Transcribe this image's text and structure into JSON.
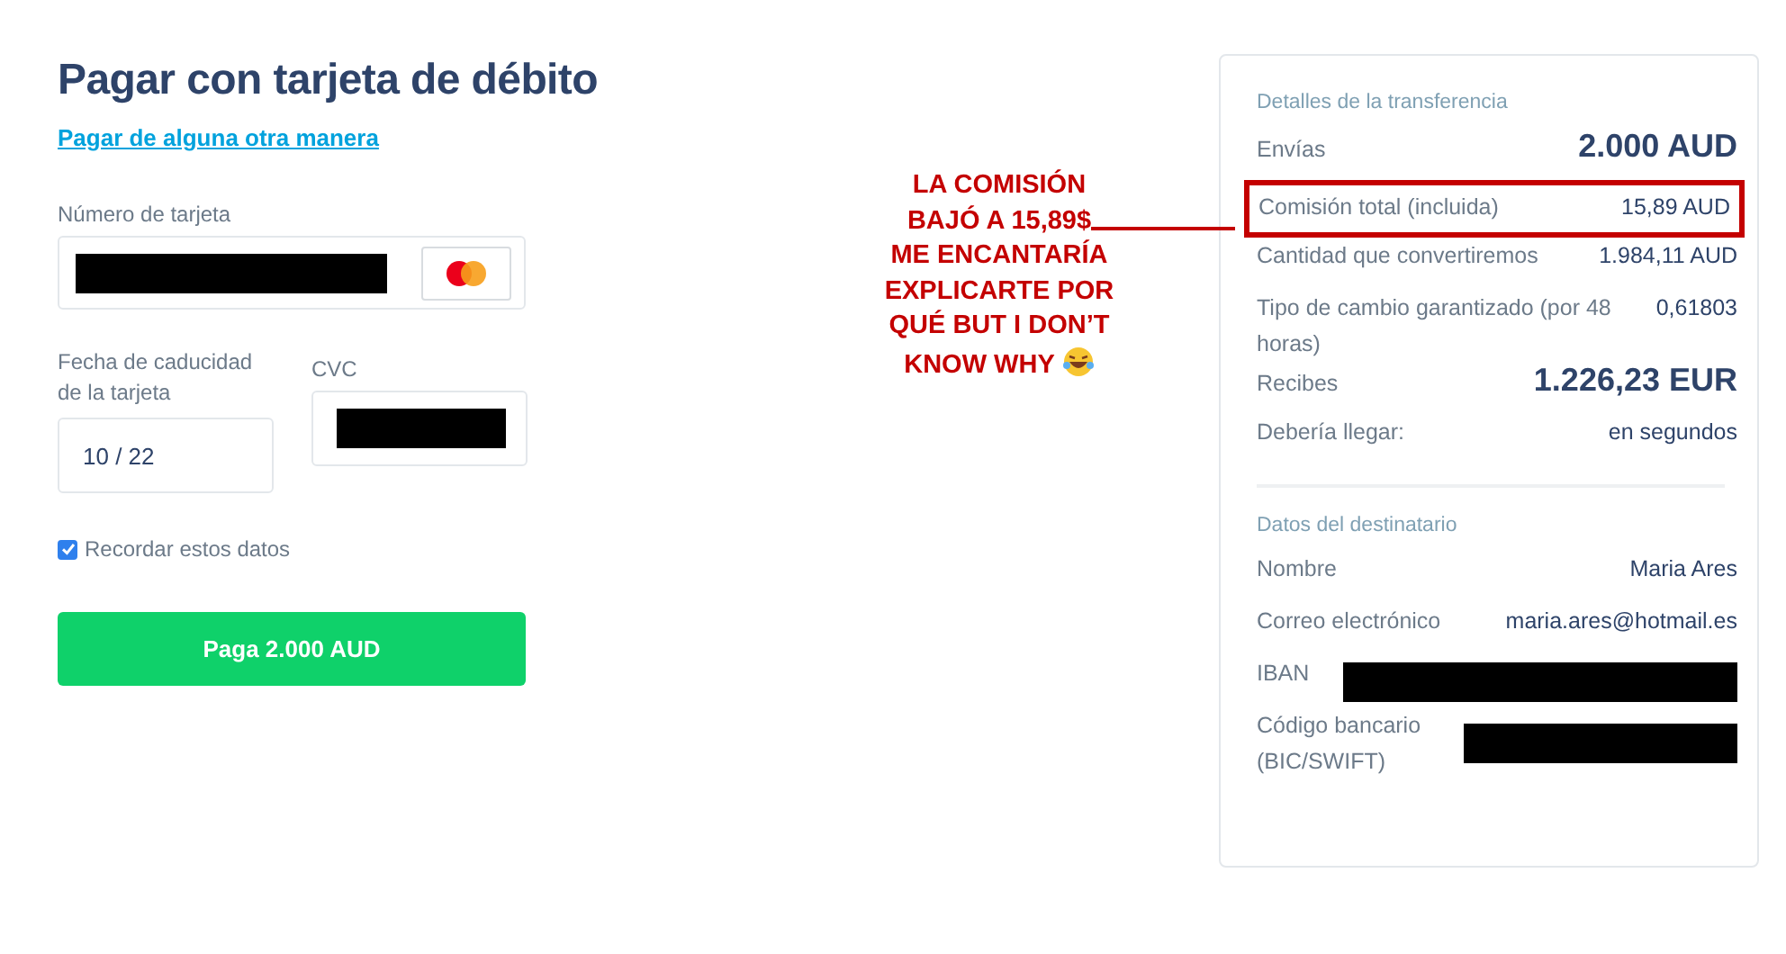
{
  "payment": {
    "title": "Pagar con tarjeta de débito",
    "other_method_link": "Pagar de alguna otra manera",
    "card_number": {
      "label": "Número de tarjeta",
      "redacted": true
    },
    "expiry": {
      "label": "Fecha de caducidad de la tarjeta",
      "value": "10 / 22"
    },
    "cvc": {
      "label": "CVC",
      "redacted": true
    },
    "remember": {
      "label": "Recordar estos datos",
      "checked": true
    },
    "pay_button": "Paga 2.000 AUD"
  },
  "annotation": {
    "lines": [
      "LA COMISIÓN",
      "BAJÓ A 15,89$",
      "ME ENCANTARÍA",
      "EXPLICARTE POR",
      "QUÉ BUT I DON’T",
      "KNOW WHY"
    ]
  },
  "details": {
    "heading": "Detalles de la transferencia",
    "rows": [
      {
        "label": "Envías",
        "value": "2.000 AUD",
        "kind": "large",
        "highlighted": false
      },
      {
        "label": "Comisión total (incluida)",
        "value": "15,89 AUD",
        "kind": "normal",
        "highlighted": true
      },
      {
        "label": "Cantidad que convertiremos",
        "value": "1.984,11 AUD",
        "kind": "normal",
        "highlighted": false
      },
      {
        "label": "Tipo de cambio garantizado (por 48 horas)",
        "value": "0,61803",
        "kind": "normal",
        "highlighted": false
      },
      {
        "label": "Recibes",
        "value": "1.226,23 EUR",
        "kind": "large",
        "highlighted": false
      },
      {
        "label": "Debería llegar:",
        "value": "en segundos",
        "kind": "normal",
        "highlighted": false
      }
    ]
  },
  "recipient": {
    "heading": "Datos del destinatario",
    "rows": [
      {
        "label": "Nombre",
        "value": "Maria Ares",
        "redacted": false
      },
      {
        "label": "Correo electrónico",
        "value": "maria.ares@hotmail.es",
        "redacted": false
      },
      {
        "label": "IBAN",
        "redacted": true
      },
      {
        "label": "Código bancario (BIC/SWIFT)",
        "redacted": true
      }
    ]
  }
}
